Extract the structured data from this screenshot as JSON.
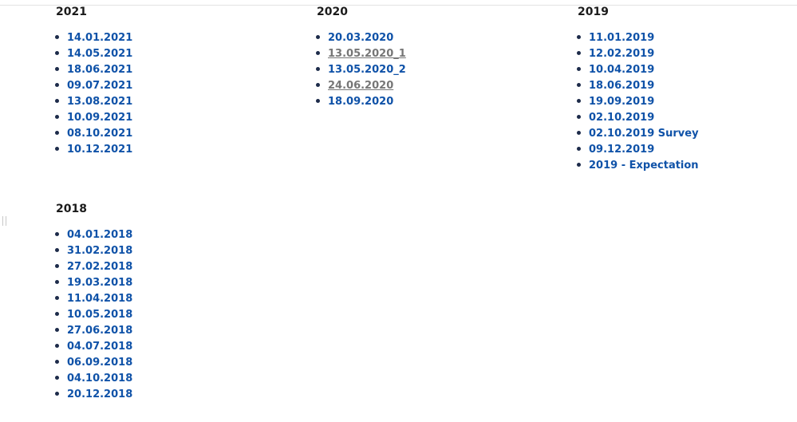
{
  "sections": [
    {
      "year": "2021",
      "items": [
        {
          "label": "14.01.2021",
          "visited": false
        },
        {
          "label": "14.05.2021",
          "visited": false
        },
        {
          "label": "18.06.2021",
          "visited": false
        },
        {
          "label": "09.07.2021",
          "visited": false
        },
        {
          "label": "13.08.2021",
          "visited": false
        },
        {
          "label": "10.09.2021",
          "visited": false
        },
        {
          "label": "08.10.2021",
          "visited": false
        },
        {
          "label": "10.12.2021",
          "visited": false
        }
      ]
    },
    {
      "year": "2020",
      "items": [
        {
          "label": "20.03.2020",
          "visited": false
        },
        {
          "label": "13.05.2020_1",
          "visited": true
        },
        {
          "label": "13.05.2020_2",
          "visited": false
        },
        {
          "label": "24.06.2020",
          "visited": true
        },
        {
          "label": "18.09.2020",
          "visited": false
        }
      ]
    },
    {
      "year": "2019",
      "items": [
        {
          "label": "11.01.2019",
          "visited": false
        },
        {
          "label": "12.02.2019",
          "visited": false
        },
        {
          "label": "10.04.2019",
          "visited": false
        },
        {
          "label": "18.06.2019",
          "visited": false
        },
        {
          "label": "19.09.2019",
          "visited": false
        },
        {
          "label": "02.10.2019",
          "visited": false
        },
        {
          "label": "02.10.2019 Survey",
          "visited": false
        },
        {
          "label": "09.12.2019",
          "visited": false
        },
        {
          "label": "2019 - Expectation",
          "visited": false
        }
      ]
    },
    {
      "year": "2018",
      "items": [
        {
          "label": "04.01.2018",
          "visited": false
        },
        {
          "label": "31.02.2018",
          "visited": false
        },
        {
          "label": "27.02.2018",
          "visited": false
        },
        {
          "label": "19.03.2018",
          "visited": false
        },
        {
          "label": "11.04.2018",
          "visited": false
        },
        {
          "label": "10.05.2018",
          "visited": false
        },
        {
          "label": "27.06.2018",
          "visited": false
        },
        {
          "label": "04.07.2018",
          "visited": false
        },
        {
          "label": "06.09.2018",
          "visited": false
        },
        {
          "label": "04.10.2018",
          "visited": false
        },
        {
          "label": "20.12.2018",
          "visited": false
        }
      ]
    }
  ],
  "colors": {
    "link": "#0f52a8",
    "visited_link": "#767676",
    "heading": "#1b1b1b",
    "bullet": "#1d2b4a"
  }
}
